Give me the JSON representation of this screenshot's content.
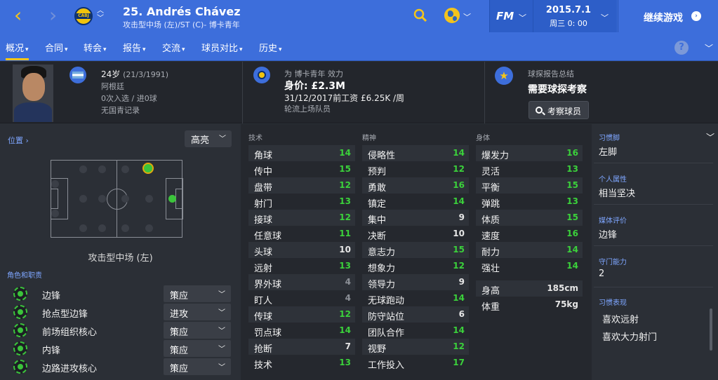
{
  "header": {
    "back_icon": "chevron-left-icon",
    "forward_icon": "chevron-right-icon",
    "club_badge_text": "CABJ",
    "player_name": "25. Andrés Chávez",
    "player_position": "攻击型中场 (左)/ST (C)- 博卡青年",
    "fm_logo": "FM",
    "date": "2015.7.1",
    "date_sub": "周三 0: 00",
    "continue_label": "继续游戏"
  },
  "tabs": [
    {
      "label": "概况",
      "active": true
    },
    {
      "label": "合同"
    },
    {
      "label": "转会"
    },
    {
      "label": "报告"
    },
    {
      "label": "交流"
    },
    {
      "label": "球员对比"
    },
    {
      "label": "历史"
    }
  ],
  "help_label": "?",
  "info": {
    "age": "24岁",
    "dob": "(21/3/1991)",
    "nationality": "阿根廷",
    "caps": "0次入选 / 进0球",
    "youth": "无国青记录",
    "plays_for": "为 博卡青年 效力",
    "value": "身价: £2.3M",
    "contract": "31/12/2017前工资 £6.25K /周",
    "squad_status": "轮流上场队员",
    "scout_title": "球探报告总结",
    "scout_needed": "需要球探考察",
    "scout_button": "考察球员"
  },
  "position": {
    "link": "位置 ›",
    "dropdown": "高亮",
    "label": "攻击型中场 (左)"
  },
  "roles": {
    "title": "角色和职责",
    "items": [
      {
        "name": "边锋",
        "duty": "策应"
      },
      {
        "name": "抢点型边锋",
        "duty": "进攻"
      },
      {
        "name": "前场组织核心",
        "duty": "策应"
      },
      {
        "name": "内锋",
        "duty": "策应"
      },
      {
        "name": "边路进攻核心",
        "duty": "策应"
      }
    ]
  },
  "attributes": {
    "technical_title": "技术",
    "mental_title": "精神",
    "physical_title": "身体",
    "technical": [
      {
        "name": "角球",
        "value": "14"
      },
      {
        "name": "传中",
        "value": "15"
      },
      {
        "name": "盘带",
        "value": "12"
      },
      {
        "name": "射门",
        "value": "13"
      },
      {
        "name": "接球",
        "value": "12"
      },
      {
        "name": "任意球",
        "value": "11"
      },
      {
        "name": "头球",
        "value": "10"
      },
      {
        "name": "远射",
        "value": "13"
      },
      {
        "name": "界外球",
        "value": "4"
      },
      {
        "name": "盯人",
        "value": "4"
      },
      {
        "name": "传球",
        "value": "12"
      },
      {
        "name": "罚点球",
        "value": "14"
      },
      {
        "name": "抢断",
        "value": "7"
      },
      {
        "name": "技术",
        "value": "13"
      }
    ],
    "mental": [
      {
        "name": "侵略性",
        "value": "14"
      },
      {
        "name": "预判",
        "value": "12"
      },
      {
        "name": "勇敢",
        "value": "16"
      },
      {
        "name": "镇定",
        "value": "14"
      },
      {
        "name": "集中",
        "value": "9"
      },
      {
        "name": "决断",
        "value": "10"
      },
      {
        "name": "意志力",
        "value": "15"
      },
      {
        "name": "想象力",
        "value": "12"
      },
      {
        "name": "领导力",
        "value": "9"
      },
      {
        "name": "无球跑动",
        "value": "14"
      },
      {
        "name": "防守站位",
        "value": "6"
      },
      {
        "name": "团队合作",
        "value": "14"
      },
      {
        "name": "视野",
        "value": "12"
      },
      {
        "name": "工作投入",
        "value": "17"
      }
    ],
    "physical": [
      {
        "name": "爆发力",
        "value": "16"
      },
      {
        "name": "灵活",
        "value": "13"
      },
      {
        "name": "平衡",
        "value": "15"
      },
      {
        "name": "弹跳",
        "value": "13"
      },
      {
        "name": "体质",
        "value": "15"
      },
      {
        "name": "速度",
        "value": "16"
      },
      {
        "name": "耐力",
        "value": "14"
      },
      {
        "name": "强壮",
        "value": "14"
      }
    ],
    "height_label": "身高",
    "height_value": "185cm",
    "weight_label": "体重",
    "weight_value": "75kg"
  },
  "side": {
    "foot_label": "习惯脚",
    "foot_value": "左脚",
    "personality_label": "个人属性",
    "personality_value": "相当坚决",
    "media_label": "媒体评价",
    "media_value": "边锋",
    "defence_label": "守门能力",
    "defence_value": "2",
    "habits_label": "习惯表现",
    "habits": [
      "喜欢远射",
      "喜欢大力射门"
    ]
  },
  "colors": {
    "accent": "#3d6edb",
    "good": "#3bd13b",
    "highlight": "#f5c518"
  }
}
